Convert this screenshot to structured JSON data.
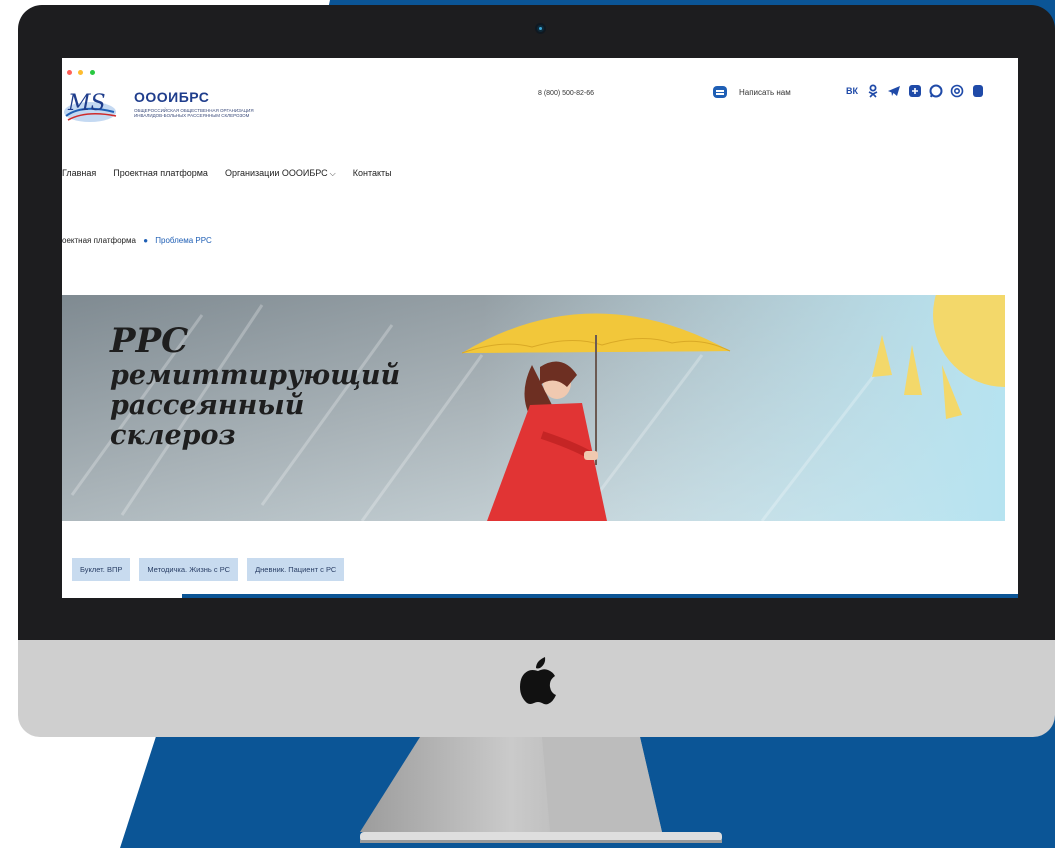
{
  "colors": {
    "backdrop_blue": "#0b5596",
    "bezel": "#1d1d1f",
    "chin": "#cfcfcf",
    "brand_blue": "#1f5fb5",
    "tag_bg": "#c8dbef"
  },
  "device": {
    "logo_icon": "apple-logo-icon",
    "camera_icon": "camera-icon"
  },
  "site": {
    "window_dots": [
      "#ff5f57",
      "#febc2e",
      "#28c840"
    ],
    "org_name": "ОООИБРС",
    "org_subtitle": "Общероссийская общественная организация инвалидов-больных рассеянным склерозом",
    "phone": "8 (800) 500-82-66",
    "write_us_label": "Написать нам",
    "socials": [
      "vk-icon",
      "odnoklassniki-icon",
      "telegram-icon",
      "plus-icon",
      "whatsapp-icon",
      "at-icon"
    ],
    "vk_label": "ВК"
  },
  "nav": {
    "items": [
      "Главная",
      "Проектная платформа",
      "Организации ОООИБРС",
      "Контакты"
    ]
  },
  "breadcrumb": {
    "parent": "оектная платформа",
    "current": "Проблема РРС"
  },
  "banner": {
    "title": "РРС",
    "lines": [
      "ремиттирующий",
      "рассеянный",
      "склероз"
    ]
  },
  "tags": [
    "Буклет. ВПР",
    "Методичка. Жизнь с РС",
    "Дневник. Пациент с РС"
  ]
}
